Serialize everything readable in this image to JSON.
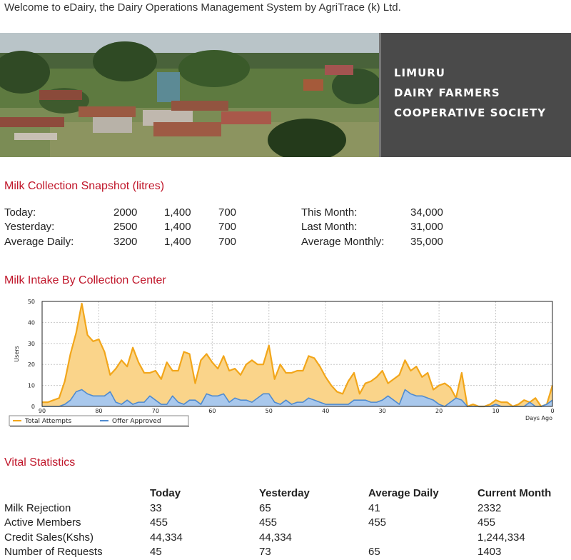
{
  "header": {
    "welcome_text": "Welcome to eDairy, the Dairy Operations Management System by AgriTrace (k) Ltd."
  },
  "banner": {
    "photo_icon": "village-landscape-photo",
    "org_lines": [
      "LIMURU",
      "DAIRY FARMERS",
      "COOPERATIVE SOCIETY"
    ]
  },
  "snapshot": {
    "title": "Milk Collection Snapshot (litres)",
    "daily_rows": [
      {
        "label": "Today:",
        "v1": "2000",
        "v2": "1,400",
        "v3": "700"
      },
      {
        "label": "Yesterday:",
        "v1": "2500",
        "v2": "1,400",
        "v3": "700"
      },
      {
        "label": "Average Daily:",
        "v1": "3200",
        "v2": "1,400",
        "v3": "700"
      }
    ],
    "monthly_rows": [
      {
        "label": "This Month:",
        "value": "34,000"
      },
      {
        "label": "Last Month:",
        "value": "31,000"
      },
      {
        "label": "Average Monthly:",
        "value": "35,000"
      }
    ]
  },
  "intake": {
    "title": "Milk Intake By Collection Center"
  },
  "chart_data": {
    "type": "area",
    "title": "",
    "xlabel": "Days Ago",
    "ylabel": "Users",
    "x_reversed": true,
    "xlim": [
      90,
      0
    ],
    "ylim": [
      0,
      50
    ],
    "x_ticks": [
      "90",
      "80",
      "70",
      "60",
      "50",
      "40",
      "30",
      "20",
      "10",
      "0"
    ],
    "y_ticks": [
      "0",
      "10",
      "20",
      "30",
      "40",
      "50"
    ],
    "grid": true,
    "legend_position": "bottom-left",
    "colors": {
      "total": "#f2a61a",
      "total_fill": "#fad48a",
      "approved": "#4f8bd0",
      "approved_fill": "#a9c8ec"
    },
    "x": [
      90,
      89,
      88,
      87,
      86,
      85,
      84,
      83,
      82,
      81,
      80,
      79,
      78,
      77,
      76,
      75,
      74,
      73,
      72,
      71,
      70,
      69,
      68,
      67,
      66,
      65,
      64,
      63,
      62,
      61,
      60,
      59,
      58,
      57,
      56,
      55,
      54,
      53,
      52,
      51,
      50,
      49,
      48,
      47,
      46,
      45,
      44,
      43,
      42,
      41,
      40,
      39,
      38,
      37,
      36,
      35,
      34,
      33,
      32,
      31,
      30,
      29,
      28,
      27,
      26,
      25,
      24,
      23,
      22,
      21,
      20,
      19,
      18,
      17,
      16,
      15,
      14,
      13,
      12,
      11,
      10,
      9,
      8,
      7,
      6,
      5,
      4,
      3,
      2,
      1,
      0
    ],
    "series": [
      {
        "name": "Total Attempts",
        "values": [
          2,
          2,
          3,
          4,
          12,
          25,
          35,
          49,
          34,
          31,
          32,
          26,
          15,
          18,
          22,
          19,
          28,
          21,
          16,
          16,
          17,
          13,
          21,
          17,
          17,
          26,
          25,
          11,
          22,
          25,
          21,
          18,
          24,
          17,
          18,
          15,
          20,
          22,
          20,
          20,
          29,
          13,
          20,
          16,
          16,
          17,
          17,
          24,
          23,
          19,
          14,
          10,
          7,
          6,
          12,
          16,
          6,
          11,
          12,
          14,
          17,
          11,
          13,
          15,
          22,
          17,
          19,
          14,
          16,
          8,
          10,
          11,
          9,
          4,
          16,
          0,
          1,
          0,
          0,
          1,
          3,
          2,
          2,
          0,
          1,
          3,
          2,
          4,
          0,
          1,
          10
        ]
      },
      {
        "name": "Offer Approved",
        "values": [
          0,
          0,
          0,
          0,
          1,
          3,
          7,
          8,
          6,
          5,
          5,
          5,
          7,
          2,
          1,
          3,
          1,
          2,
          2,
          5,
          3,
          1,
          1,
          5,
          2,
          1,
          3,
          3,
          1,
          6,
          5,
          5,
          6,
          2,
          4,
          3,
          3,
          2,
          4,
          6,
          6,
          2,
          1,
          3,
          1,
          2,
          2,
          4,
          3,
          2,
          1,
          1,
          1,
          1,
          1,
          3,
          3,
          3,
          2,
          2,
          3,
          5,
          3,
          1,
          8,
          6,
          5,
          5,
          4,
          3,
          1,
          0,
          2,
          4,
          3,
          0,
          0,
          0,
          0,
          0,
          1,
          0,
          0,
          0,
          0,
          0,
          2,
          0,
          0,
          1,
          3
        ]
      }
    ]
  },
  "vital": {
    "title": "Vital Statistics",
    "columns": [
      "Today",
      "Yesterday",
      "Average Daily",
      "Current Month"
    ],
    "rows": [
      {
        "label": "Milk Rejection",
        "cells": [
          "33",
          "65",
          "41",
          "2332"
        ]
      },
      {
        "label": "Active Members",
        "cells": [
          "455",
          "455",
          "455",
          "455"
        ]
      },
      {
        "label": "Credit Sales(Kshs)",
        "cells": [
          "44,334",
          "44,334",
          "",
          "1,244,334"
        ]
      },
      {
        "label": "Number of Requests",
        "cells": [
          "45",
          "73",
          "65",
          "1403"
        ]
      }
    ]
  }
}
